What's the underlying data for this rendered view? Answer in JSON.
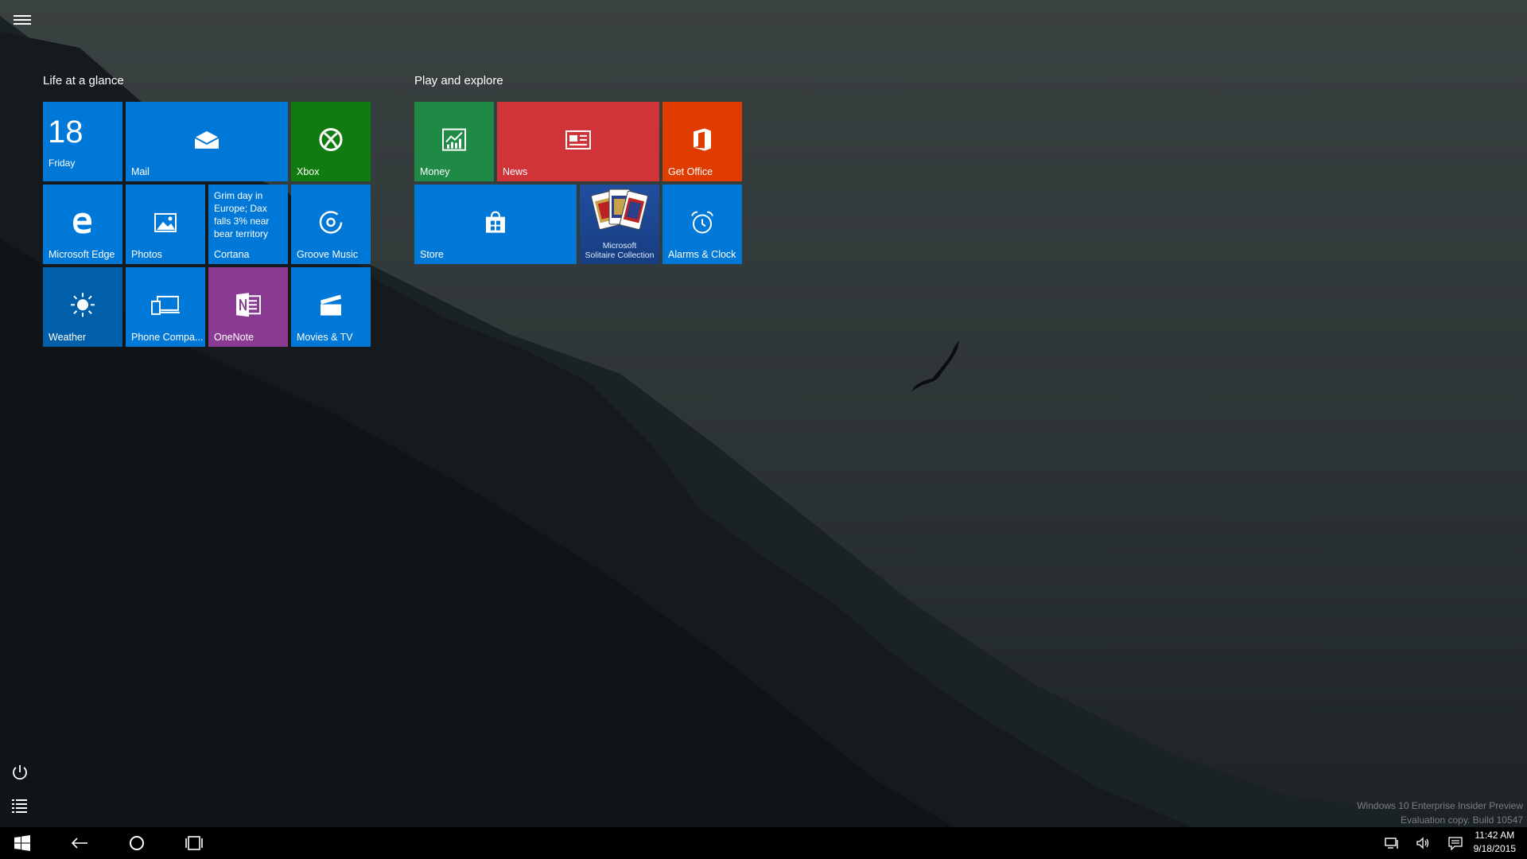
{
  "groups": [
    {
      "title": "Life at a glance"
    },
    {
      "title": "Play and explore"
    }
  ],
  "tiles": {
    "calendar": {
      "date": "18",
      "day": "Friday"
    },
    "mail": {
      "label": "Mail"
    },
    "xbox": {
      "label": "Xbox"
    },
    "edge": {
      "label": "Microsoft Edge"
    },
    "photos": {
      "label": "Photos"
    },
    "cortana": {
      "headline": "Grim day in Europe; Dax falls 3% near bear territory",
      "label": "Cortana"
    },
    "groove": {
      "label": "Groove Music"
    },
    "weather": {
      "label": "Weather"
    },
    "phone": {
      "label": "Phone Compa..."
    },
    "onenote": {
      "label": "OneNote"
    },
    "movies": {
      "label": "Movies & TV"
    },
    "money": {
      "label": "Money"
    },
    "news": {
      "label": "News"
    },
    "office": {
      "label": "Get Office"
    },
    "store": {
      "label": "Store"
    },
    "solitaire": {
      "line1": "Microsoft",
      "line2": "Solitaire Collection"
    },
    "alarms": {
      "label": "Alarms & Clock"
    }
  },
  "watermark": {
    "line1": "Windows 10 Enterprise Insider Preview",
    "line2": "Evaluation copy. Build 10547"
  },
  "clock": {
    "time": "11:42 AM",
    "date": "9/18/2015"
  },
  "icons": [
    "hamburger-menu-icon",
    "power-icon",
    "all-apps-list-icon",
    "windows-start-icon",
    "back-arrow-icon",
    "search-circle-icon",
    "task-view-icon",
    "network-icon",
    "volume-icon",
    "action-center-icon"
  ],
  "colors": {
    "blue": "#0078d7",
    "green": "#107c10",
    "red": "#d13438",
    "orange": "#e03c00",
    "purple": "#8a3a93"
  }
}
